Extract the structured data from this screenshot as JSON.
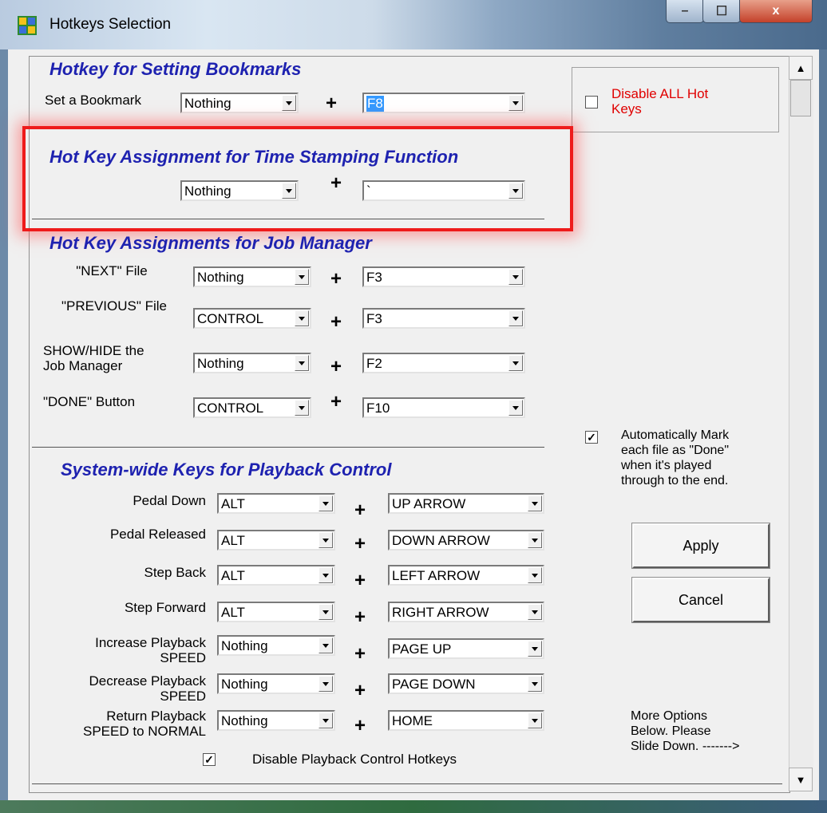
{
  "window": {
    "title": "Hotkeys Selection",
    "min": "–",
    "max": "☐",
    "close": "x"
  },
  "bookmarks": {
    "heading": "Hotkey for Setting Bookmarks",
    "label": "Set a Bookmark",
    "modifier": "Nothing",
    "key": "F8"
  },
  "disable_all": {
    "label_line1": "Disable ALL Hot",
    "label_line2": "Keys",
    "checked": false
  },
  "timestamp": {
    "heading": "Hot Key Assignment for Time Stamping Function",
    "modifier": "Nothing",
    "key": "`"
  },
  "job_manager": {
    "heading": "Hot Key Assignments for Job Manager",
    "rows": [
      {
        "label1": "\"NEXT\" File",
        "label2": "",
        "modifier": "Nothing",
        "key": "F3"
      },
      {
        "label1": "\"PREVIOUS\" File",
        "label2": "",
        "modifier": "CONTROL",
        "key": "F3"
      },
      {
        "label1": "SHOW/HIDE the",
        "label2": "Job Manager",
        "modifier": "Nothing",
        "key": "F2"
      },
      {
        "label1": "\"DONE\" Button",
        "label2": "",
        "modifier": "CONTROL",
        "key": "F10"
      }
    ]
  },
  "auto_mark": {
    "checked": true,
    "lines": [
      "Automatically Mark",
      "each file as \"Done\"",
      "when it's played",
      "through to the end."
    ]
  },
  "playback": {
    "heading": "System-wide Keys for Playback Control",
    "rows": [
      {
        "label1": "Pedal Down",
        "label2": "",
        "modifier": "ALT",
        "key": "UP ARROW"
      },
      {
        "label1": "Pedal Released",
        "label2": "",
        "modifier": "ALT",
        "key": "DOWN ARROW"
      },
      {
        "label1": "Step Back",
        "label2": "",
        "modifier": "ALT",
        "key": "LEFT ARROW"
      },
      {
        "label1": "Step Forward",
        "label2": "",
        "modifier": "ALT",
        "key": "RIGHT ARROW"
      },
      {
        "label1": "Increase Playback",
        "label2": "SPEED",
        "modifier": "Nothing",
        "key": "PAGE UP"
      },
      {
        "label1": "Decrease Playback",
        "label2": "SPEED",
        "modifier": "Nothing",
        "key": "PAGE DOWN"
      },
      {
        "label1": "Return Playback",
        "label2": "SPEED to NORMAL",
        "modifier": "Nothing",
        "key": "HOME"
      }
    ],
    "disable_label": "Disable Playback Control Hotkeys",
    "disable_checked": true
  },
  "buttons": {
    "apply": "Apply",
    "cancel": "Cancel"
  },
  "more_options": [
    "More Options",
    "Below.  Please",
    "Slide Down. ------->"
  ],
  "plus_sign": "+",
  "check_glyph": "✓"
}
